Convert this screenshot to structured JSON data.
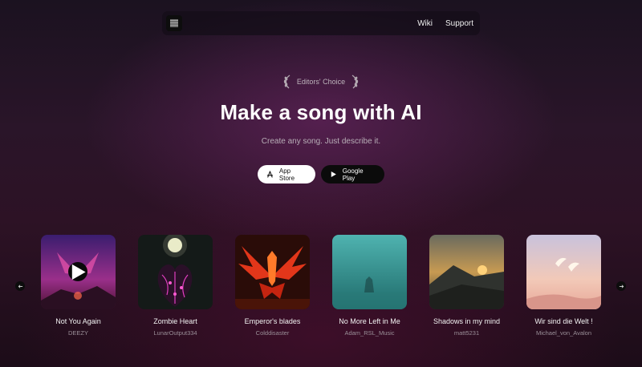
{
  "nav": {
    "logo_icon": "app-logo-icon",
    "links": [
      "Wiki",
      "Support"
    ]
  },
  "hero": {
    "badge": "Editors' Choice",
    "title": "Make a song with AI",
    "subtitle": "Create any song. Just describe it.",
    "app_store": "App Store",
    "google_play": "Google Play"
  },
  "carousel": {
    "prev_icon": "arrow-left-icon",
    "next_icon": "arrow-right-icon",
    "songs": [
      {
        "title": "Not You Again",
        "artist": "DEEZY",
        "playing_icon": "play-icon"
      },
      {
        "title": "Zombie Heart",
        "artist": "LunarOutput334"
      },
      {
        "title": "Emperor's blades",
        "artist": "Colddisaster"
      },
      {
        "title": "No More Left in Me",
        "artist": "Adam_RSL_Music"
      },
      {
        "title": "Shadows in my mind",
        "artist": "matt5231"
      },
      {
        "title": "Wir sind die Welt !",
        "artist": "Michael_von_Avalon"
      }
    ]
  },
  "colors": {
    "background": "#2a1529",
    "primary_button": "#ffffff",
    "secondary_button": "#0b0b0b"
  }
}
